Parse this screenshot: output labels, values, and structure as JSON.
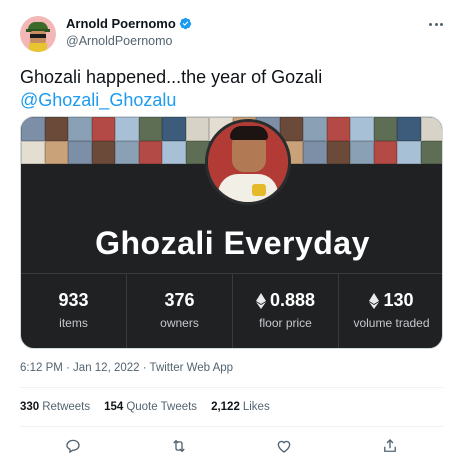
{
  "author": {
    "display_name": "Arnold Poernomo",
    "handle": "@ArnoldPoernomo",
    "verified": true,
    "avatar_icon": "pixel-art-avatar-icon"
  },
  "tweet": {
    "text": "Ghozali happened...the year of Gozali",
    "mention": "@Ghozali_Ghozalu"
  },
  "card": {
    "title": "Ghozali Everyday",
    "stats": [
      {
        "value": "933",
        "label": "items",
        "eth": false
      },
      {
        "value": "376",
        "label": "owners",
        "eth": false
      },
      {
        "value": "0.888",
        "label": "floor price",
        "eth": true
      },
      {
        "value": "130",
        "label": "volume traded",
        "eth": true
      }
    ]
  },
  "meta": {
    "timestamp": "6:12 PM · Jan 12, 2022 · Twitter Web App"
  },
  "engagement": {
    "retweets_count": "330",
    "retweets_label": "Retweets",
    "quotes_count": "154",
    "quotes_label": "Quote Tweets",
    "likes_count": "2,122",
    "likes_label": "Likes"
  },
  "colors": {
    "link": "#1d9bf0",
    "card_bg": "#1f2123",
    "secondary_text": "#536471"
  }
}
